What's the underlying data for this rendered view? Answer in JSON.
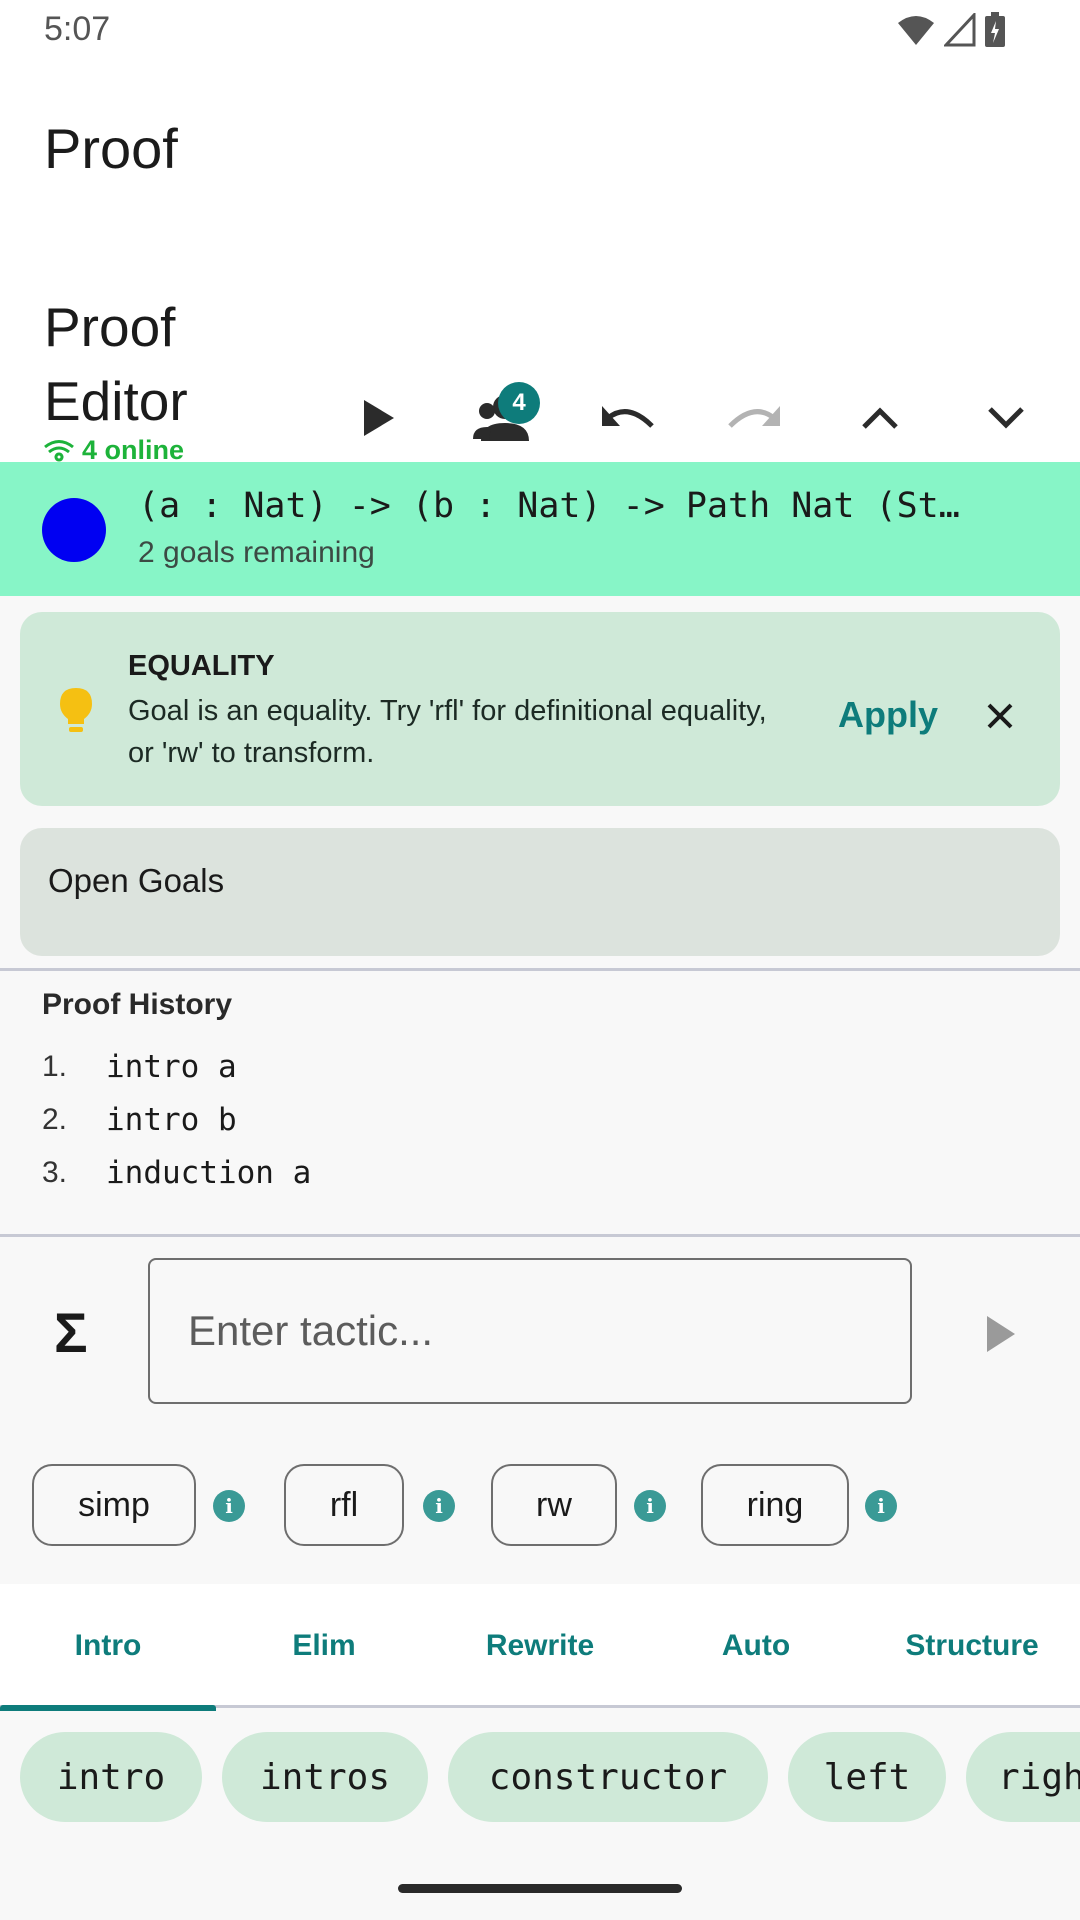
{
  "status": {
    "time": "5:07"
  },
  "app": {
    "title": "Proof",
    "editor_title": "Proof Editor",
    "online_text": "4 online",
    "collaborators_count": "4"
  },
  "goal": {
    "statement": "(a : Nat) -> (b : Nat) -> Path Nat (St…",
    "remaining": "2 goals remaining",
    "status_color": "#0000f2"
  },
  "hint": {
    "title": "EQUALITY",
    "body": "Goal is an equality. Try 'rfl' for definitional equality, or 'rw' to transform.",
    "apply_label": "Apply"
  },
  "open_goals": {
    "title": "Open Goals"
  },
  "history": {
    "title": "Proof History",
    "items": [
      {
        "num": "1.",
        "cmd": "intro a"
      },
      {
        "num": "2.",
        "cmd": "intro b"
      },
      {
        "num": "3.",
        "cmd": "induction a"
      }
    ]
  },
  "input": {
    "sigma": "Σ",
    "placeholder": "Enter tactic..."
  },
  "suggestions": [
    {
      "label": "simp"
    },
    {
      "label": "rfl"
    },
    {
      "label": "rw"
    },
    {
      "label": "ring"
    }
  ],
  "tabs": [
    {
      "label": "Intro",
      "selected": true
    },
    {
      "label": "Elim"
    },
    {
      "label": "Rewrite"
    },
    {
      "label": "Auto"
    },
    {
      "label": "Structure"
    }
  ],
  "tactic_pills": [
    "intro",
    "intros",
    "constructor",
    "left",
    "right"
  ],
  "colors": {
    "accent": "#0e7c7b",
    "goal_bar": "#87f5c7",
    "hint_bg": "#cfe9d8",
    "online": "#1db33a"
  }
}
